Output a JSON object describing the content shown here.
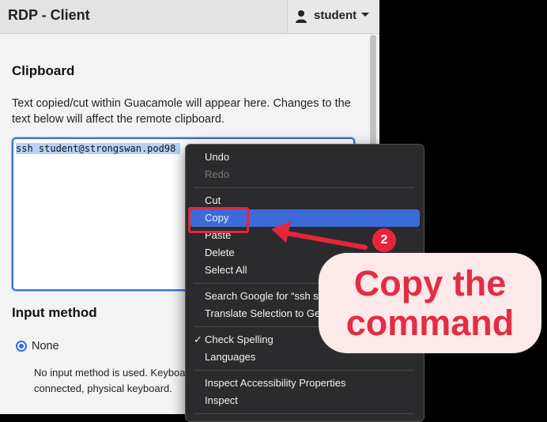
{
  "header": {
    "title": "RDP - Client",
    "user": "student"
  },
  "clipboard": {
    "title": "Clipboard",
    "description": "Text copied/cut within Guacamole will appear here. Changes to the text below will affect the remote clipboard.",
    "content": "ssh student@strongswan.pod98"
  },
  "input_method": {
    "title": "Input method",
    "selected": "None",
    "description_lines": [
      "No input method is used. Keyboa",
      "connected, physical keyboard."
    ]
  },
  "context_menu": {
    "undo": "Undo",
    "redo": "Redo",
    "cut": "Cut",
    "copy": "Copy",
    "paste": "Paste",
    "delete": "Delete",
    "select_all": "Select All",
    "search": "Search Google for “ssh stu",
    "translate": "Translate Selection to Ge",
    "check_spelling": "Check Spelling",
    "check_mark": "✓",
    "languages": "Languages",
    "inspect_accessibility": "Inspect Accessibility Properties",
    "inspect": "Inspect"
  },
  "annotation": {
    "step": "2",
    "callout_line1": "Copy the",
    "callout_line2": "command",
    "color": "#e6253a"
  }
}
